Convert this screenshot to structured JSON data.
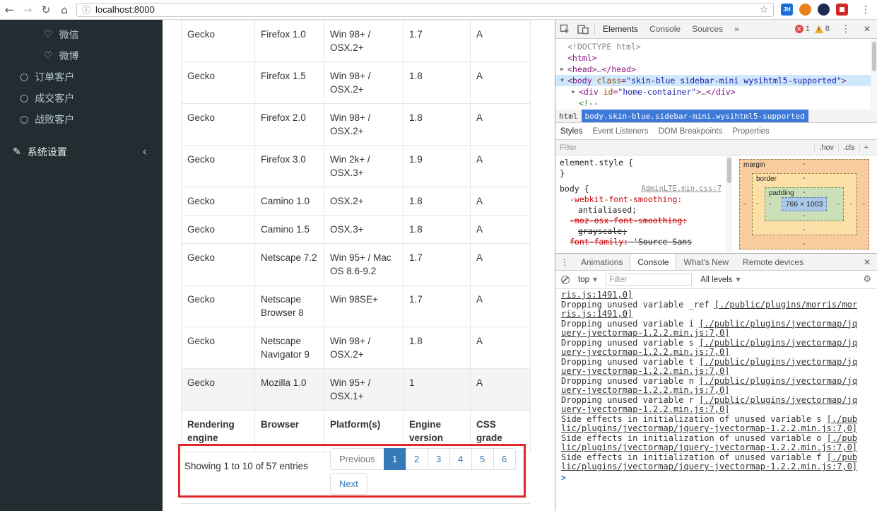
{
  "browser": {
    "url": "localhost:8000",
    "extension_jh": "JH"
  },
  "sidebar": {
    "items": [
      {
        "label": "微信",
        "icon": "heart"
      },
      {
        "label": "微博",
        "icon": "heart"
      },
      {
        "label": "订单客户",
        "icon": "circle"
      },
      {
        "label": "成交客户",
        "icon": "circle"
      },
      {
        "label": "战败客户",
        "icon": "circle"
      }
    ],
    "settings": {
      "label": "系统设置",
      "chevron": "‹"
    }
  },
  "table": {
    "rows": [
      {
        "engine": "Gecko",
        "browser": "Firefox 1.0",
        "platform": "Win 98+ / OSX.2+",
        "version": "1.7",
        "grade": "A"
      },
      {
        "engine": "Gecko",
        "browser": "Firefox 1.5",
        "platform": "Win 98+ / OSX.2+",
        "version": "1.8",
        "grade": "A"
      },
      {
        "engine": "Gecko",
        "browser": "Firefox 2.0",
        "platform": "Win 98+ / OSX.2+",
        "version": "1.8",
        "grade": "A"
      },
      {
        "engine": "Gecko",
        "browser": "Firefox 3.0",
        "platform": "Win 2k+ / OSX.3+",
        "version": "1.9",
        "grade": "A"
      },
      {
        "engine": "Gecko",
        "browser": "Camino 1.0",
        "platform": "OSX.2+",
        "version": "1.8",
        "grade": "A"
      },
      {
        "engine": "Gecko",
        "browser": "Camino 1.5",
        "platform": "OSX.3+",
        "version": "1.8",
        "grade": "A"
      },
      {
        "engine": "Gecko",
        "browser": "Netscape 7.2",
        "platform": "Win 95+ / Mac OS 8.6-9.2",
        "version": "1.7",
        "grade": "A"
      },
      {
        "engine": "Gecko",
        "browser": "Netscape Browser 8",
        "platform": "Win 98SE+",
        "version": "1.7",
        "grade": "A"
      },
      {
        "engine": "Gecko",
        "browser": "Netscape Navigator 9",
        "platform": "Win 98+ / OSX.2+",
        "version": "1.8",
        "grade": "A"
      },
      {
        "engine": "Gecko",
        "browser": "Mozilla 1.0",
        "platform": "Win 95+ / OSX.1+",
        "version": "1",
        "grade": "A"
      }
    ],
    "footer": [
      "Rendering engine",
      "Browser",
      "Platform(s)",
      "Engine version",
      "CSS grade"
    ],
    "info": "Showing 1 to 10 of 57 entries",
    "pagination": {
      "previous": "Previous",
      "pages": [
        "1",
        "2",
        "3",
        "4",
        "5",
        "6"
      ],
      "active_page": "1",
      "next": "Next"
    }
  },
  "devtools": {
    "toolbar": {
      "tabs": [
        "Elements",
        "Console",
        "Sources"
      ],
      "more": "»",
      "error_count": "1",
      "warning_count": "8"
    },
    "elements": {
      "tree": [
        {
          "indent": 0,
          "arrow": "",
          "selected": false,
          "segments": [
            {
              "t": "<!DOCTYPE html>",
              "c": "doctype"
            }
          ]
        },
        {
          "indent": 0,
          "arrow": "",
          "selected": false,
          "segments": [
            {
              "t": "<html>",
              "c": "tag"
            }
          ]
        },
        {
          "indent": 0,
          "arrow": "▶",
          "selected": false,
          "segments": [
            {
              "t": "<head>",
              "c": "tag"
            },
            {
              "t": "…",
              "c": "ell"
            },
            {
              "t": "</head>",
              "c": "tag"
            }
          ]
        },
        {
          "indent": 0,
          "arrow": "▼",
          "selected": true,
          "segments": [
            {
              "t": "<body ",
              "c": "tag"
            },
            {
              "t": "class",
              "c": "attr"
            },
            {
              "t": "=",
              "c": "tag"
            },
            {
              "t": "\"skin-blue sidebar-mini wysihtml5-supported\"",
              "c": "val"
            },
            {
              "t": ">",
              "c": "tag"
            }
          ]
        },
        {
          "indent": 1,
          "arrow": "▶",
          "selected": false,
          "segments": [
            {
              "t": "<div ",
              "c": "tag"
            },
            {
              "t": "id",
              "c": "attr"
            },
            {
              "t": "=",
              "c": "tag"
            },
            {
              "t": "\"home-container\"",
              "c": "val"
            },
            {
              "t": ">",
              "c": "tag"
            },
            {
              "t": "…",
              "c": "ell"
            },
            {
              "t": "</div>",
              "c": "tag"
            }
          ]
        },
        {
          "indent": 1,
          "arrow": "",
          "selected": false,
          "segments": [
            {
              "t": "<!--",
              "c": "comment"
            }
          ]
        }
      ],
      "breadcrumbs": [
        "html",
        "body.skin-blue.sidebar-mini.wysihtml5-supported"
      ]
    },
    "sidebar_tabs": [
      "Styles",
      "Event Listeners",
      "DOM Breakpoints",
      "Properties"
    ],
    "styles": {
      "filter_placeholder": "Filter",
      "tokens": [
        ":hov",
        ".cls",
        "+"
      ],
      "lines": [
        {
          "sel": "element.style {"
        },
        {
          "sel": "}"
        },
        {
          "sel": "body {",
          "link": "AdminLTE.min.css:7",
          "cls": "body-rule"
        },
        {
          "prop": "-webkit-font-smoothing:"
        },
        {
          "val": "antialiased;",
          "cls": "ind2"
        },
        {
          "prop": "-moz-osx-font-smoothing:",
          "struck": true
        },
        {
          "val": "grayscale;",
          "struck": true,
          "cls": "ind2"
        },
        {
          "prop": "font-family:",
          "val": " 'Source Sans",
          "struck": true
        }
      ]
    },
    "boxmodel": {
      "margin_label": "margin",
      "border_label": "border",
      "padding_label": "padding",
      "content_size": "766 × 1003",
      "dash": "-"
    },
    "console": {
      "drawer_tabs": [
        "Animations",
        "Console",
        "What's New",
        "Remote devices"
      ],
      "context": "top",
      "filter_placeholder": "Filter",
      "levels": "All levels",
      "messages": [
        {
          "text": "",
          "link": "ris.js:1491,0]"
        },
        {
          "text": "Dropping unused variable _ref ",
          "link": "[./public/plugins/morris/morris.js:1491,0]"
        },
        {
          "text": "Dropping unused variable i ",
          "link": "[./public/plugins/jvectormap/jquery-jvectormap-1.2.2.min.js:7,0]"
        },
        {
          "text": "Dropping unused variable s ",
          "link": "[./public/plugins/jvectormap/jquery-jvectormap-1.2.2.min.js:7,0]"
        },
        {
          "text": "Dropping unused variable t ",
          "link": "[./public/plugins/jvectormap/jquery-jvectormap-1.2.2.min.js:7,0]"
        },
        {
          "text": "Dropping unused variable n ",
          "link": "[./public/plugins/jvectormap/jquery-jvectormap-1.2.2.min.js:7,0]"
        },
        {
          "text": "Dropping unused variable r ",
          "link": "[./public/plugins/jvectormap/jquery-jvectormap-1.2.2.min.js:7,0]"
        },
        {
          "text": "Side effects in initialization of unused variable s ",
          "link": "[./public/plugins/jvectormap/jquery-jvectormap-1.2.2.min.js:7,0]"
        },
        {
          "text": "Side effects in initialization of unused variable o ",
          "link": "[./public/plugins/jvectormap/jquery-jvectormap-1.2.2.min.js:7,0]"
        },
        {
          "text": "Side effects in initialization of unused variable f ",
          "link": "[./public/plugins/jvectormap/jquery-jvectormap-1.2.2.min.js:7,0]"
        }
      ],
      "prompt": ">"
    }
  }
}
